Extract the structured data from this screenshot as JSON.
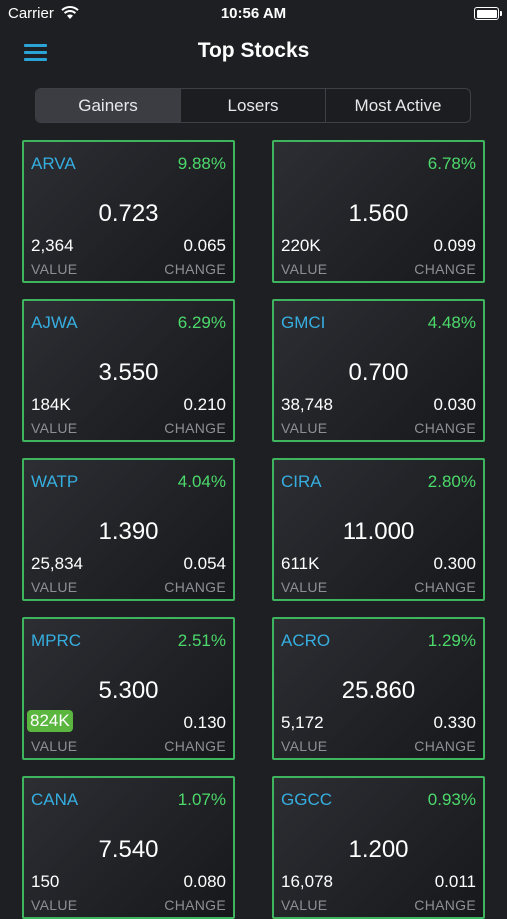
{
  "status_bar": {
    "carrier": "Carrier",
    "time": "10:56 AM"
  },
  "nav": {
    "title": "Top Stocks"
  },
  "tabs": [
    {
      "label": "Gainers",
      "active": true
    },
    {
      "label": "Losers",
      "active": false
    },
    {
      "label": "Most Active",
      "active": false
    }
  ],
  "card_labels": {
    "value": "VALUE",
    "change": "CHANGE"
  },
  "colors": {
    "accent": "#36aee0",
    "gain": "#4cd96b",
    "border": "#3fb45e",
    "highlight": "#5bb640"
  },
  "stocks": [
    {
      "symbol": "ARVA",
      "percent": "9.88%",
      "price": "0.723",
      "value": "2,364",
      "change": "0.065"
    },
    {
      "symbol": "",
      "percent": "6.78%",
      "price": "1.560",
      "value": "220K",
      "change": "0.099"
    },
    {
      "symbol": "AJWA",
      "percent": "6.29%",
      "price": "3.550",
      "value": "184K",
      "change": "0.210"
    },
    {
      "symbol": "GMCI",
      "percent": "4.48%",
      "price": "0.700",
      "value": "38,748",
      "change": "0.030"
    },
    {
      "symbol": "WATP",
      "percent": "4.04%",
      "price": "1.390",
      "value": "25,834",
      "change": "0.054"
    },
    {
      "symbol": "CIRA",
      "percent": "2.80%",
      "price": "11.000",
      "value": "611K",
      "change": "0.300"
    },
    {
      "symbol": "MPRC",
      "percent": "2.51%",
      "price": "5.300",
      "value": "824K",
      "change": "0.130",
      "value_highlight": true
    },
    {
      "symbol": "ACRO",
      "percent": "1.29%",
      "price": "25.860",
      "value": "5,172",
      "change": "0.330"
    },
    {
      "symbol": "CANA",
      "percent": "1.07%",
      "price": "7.540",
      "value": "150",
      "change": "0.080"
    },
    {
      "symbol": "GGCC",
      "percent": "0.93%",
      "price": "1.200",
      "value": "16,078",
      "change": "0.011"
    }
  ]
}
